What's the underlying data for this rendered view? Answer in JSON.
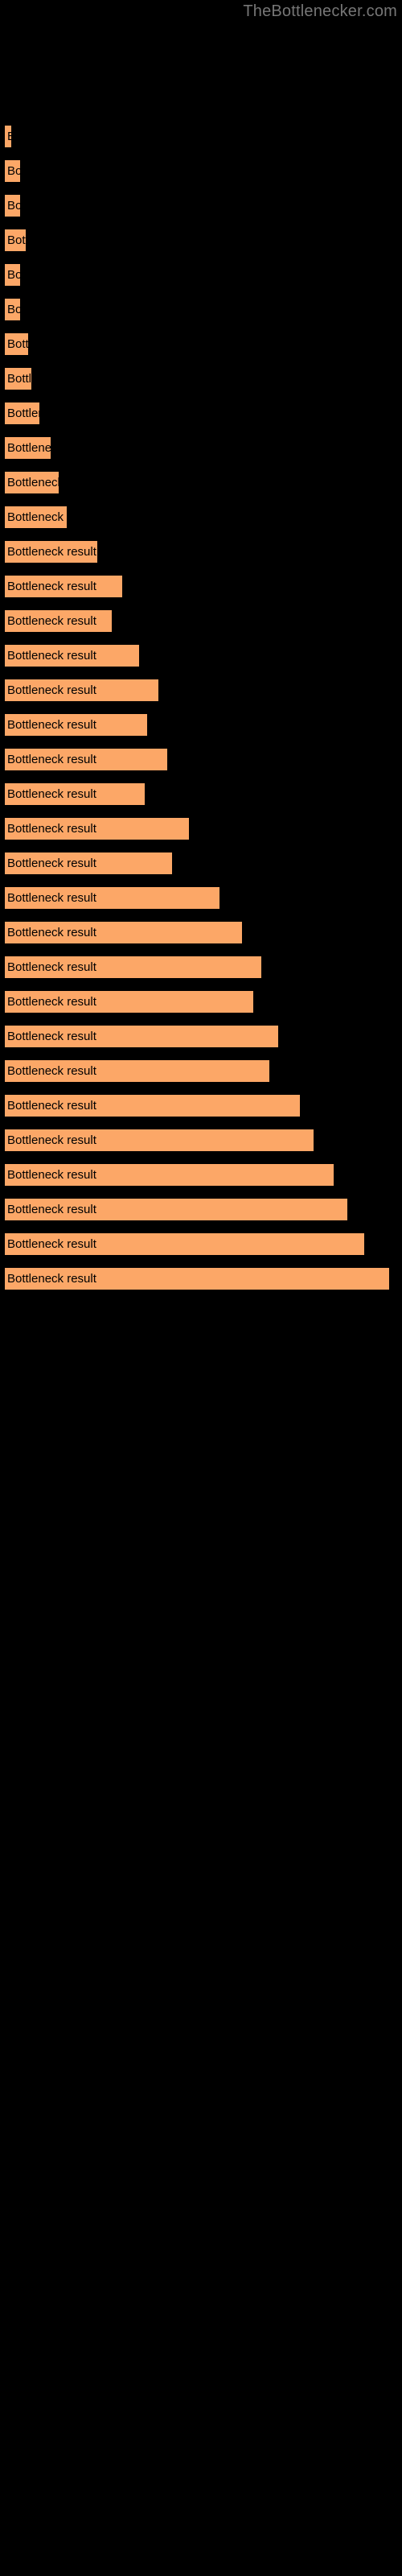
{
  "watermark": {
    "text": "TheBottlenecker.com",
    "color": "#767676"
  },
  "colors": {
    "background": "#000000",
    "bar_fill": "#FCA767",
    "bar_edge": "#000000",
    "label_text": "#000000",
    "watermark_text": "#767676"
  },
  "chart_data": {
    "type": "bar",
    "orientation": "horizontal",
    "title": "",
    "subtitle": "",
    "xlabel": "",
    "ylabel": "",
    "grid": false,
    "legend": null,
    "axis_visible": false,
    "tick_labels_visible": false,
    "bar_label_text": "Bottleneck result",
    "xlim": [
      0,
      120
    ],
    "categories": [
      "Bottleneck result",
      "Bottleneck result",
      "Bottleneck result",
      "Bottleneck result",
      "Bottleneck result",
      "Bottleneck result",
      "Bottleneck result",
      "Bottleneck result",
      "Bottleneck result",
      "Bottleneck result",
      "Bottleneck result",
      "Bottleneck result",
      "Bottleneck result",
      "Bottleneck result",
      "Bottleneck result",
      "Bottleneck result",
      "Bottleneck result",
      "Bottleneck result",
      "Bottleneck result",
      "Bottleneck result",
      "Bottleneck result",
      "Bottleneck result",
      "Bottleneck result",
      "Bottleneck result",
      "Bottleneck result",
      "Bottleneck result",
      "Bottleneck result",
      "Bottleneck result",
      "Bottleneck result",
      "Bottleneck result",
      "Bottleneck result",
      "Bottleneck result",
      "Bottleneck result",
      "Bottleneck result"
    ],
    "values": [
      1,
      4,
      4,
      5,
      4,
      4,
      6,
      6,
      9,
      11,
      13,
      15,
      22,
      29,
      26,
      33,
      38,
      35,
      40,
      34,
      45,
      41,
      53,
      58,
      63,
      61,
      67,
      65,
      72,
      76,
      80,
      84,
      88,
      94
    ],
    "bar_pixel_widths": [
      3,
      6,
      6,
      8,
      6,
      6,
      9,
      10,
      13,
      17,
      20,
      23,
      34,
      43,
      39,
      49,
      56,
      52,
      59,
      51,
      67,
      61,
      78,
      86,
      93,
      90,
      99,
      96,
      107,
      112,
      119,
      124,
      130,
      139
    ],
    "bar_rows": [
      {
        "index": 1,
        "top": 155,
        "width": 3,
        "label": "Bottleneck result"
      },
      {
        "index": 2,
        "top": 198,
        "width": 6,
        "label": "Bottleneck result"
      },
      {
        "index": 3,
        "top": 241,
        "width": 6,
        "label": "Bottleneck result"
      },
      {
        "index": 4,
        "top": 284,
        "width": 8,
        "label": "Bottleneck result"
      },
      {
        "index": 5,
        "top": 327,
        "width": 6,
        "label": "Bottleneck result"
      },
      {
        "index": 6,
        "top": 370,
        "width": 6,
        "label": "Bottleneck result"
      },
      {
        "index": 7,
        "top": 413,
        "width": 9,
        "label": "Bottleneck result"
      },
      {
        "index": 8,
        "top": 456,
        "width": 10,
        "label": "Bottleneck result"
      },
      {
        "index": 9,
        "top": 499,
        "width": 13,
        "label": "Bottleneck result"
      },
      {
        "index": 10,
        "top": 542,
        "width": 17,
        "label": "Bottleneck result"
      },
      {
        "index": 11,
        "top": 585,
        "width": 20,
        "label": "Bottleneck result"
      },
      {
        "index": 12,
        "top": 628,
        "width": 23,
        "label": "Bottleneck result"
      },
      {
        "index": 13,
        "top": 671,
        "width": 34,
        "label": "Bottleneck result"
      },
      {
        "index": 14,
        "top": 714,
        "width": 43,
        "label": "Bottleneck result"
      },
      {
        "index": 15,
        "top": 757,
        "width": 39,
        "label": "Bottleneck result"
      },
      {
        "index": 16,
        "top": 800,
        "width": 49,
        "label": "Bottleneck result"
      },
      {
        "index": 17,
        "top": 843,
        "width": 56,
        "label": "Bottleneck result"
      },
      {
        "index": 18,
        "top": 886,
        "width": 52,
        "label": "Bottleneck result"
      },
      {
        "index": 19,
        "top": 929,
        "width": 59,
        "label": "Bottleneck result"
      },
      {
        "index": 20,
        "top": 972,
        "width": 51,
        "label": "Bottleneck result"
      },
      {
        "index": 21,
        "top": 1015,
        "width": 67,
        "label": "Bottleneck result"
      },
      {
        "index": 22,
        "top": 1058,
        "width": 61,
        "label": "Bottleneck result"
      },
      {
        "index": 23,
        "top": 1101,
        "width": 78,
        "label": "Bottleneck result"
      },
      {
        "index": 24,
        "top": 1144,
        "width": 86,
        "label": "Bottleneck result"
      },
      {
        "index": 25,
        "top": 1187,
        "width": 93,
        "label": "Bottleneck result"
      },
      {
        "index": 26,
        "top": 1230,
        "width": 90,
        "label": "Bottleneck result"
      },
      {
        "index": 27,
        "top": 1273,
        "width": 99,
        "label": "Bottleneck result"
      },
      {
        "index": 28,
        "top": 1316,
        "width": 96,
        "label": "Bottleneck result"
      },
      {
        "index": 29,
        "top": 1359,
        "width": 107,
        "label": "Bottleneck result"
      },
      {
        "index": 30,
        "top": 1402,
        "width": 112,
        "label": "Bottleneck result"
      },
      {
        "index": 31,
        "top": 1445,
        "width": 119,
        "label": "Bottleneck result"
      },
      {
        "index": 32,
        "top": 1488,
        "width": 124,
        "label": "Bottleneck result"
      },
      {
        "index": 33,
        "top": 1531,
        "width": 130,
        "label": "Bottleneck result"
      },
      {
        "index": 34,
        "top": 1574,
        "width": 139,
        "label": "Bottleneck result"
      }
    ]
  }
}
